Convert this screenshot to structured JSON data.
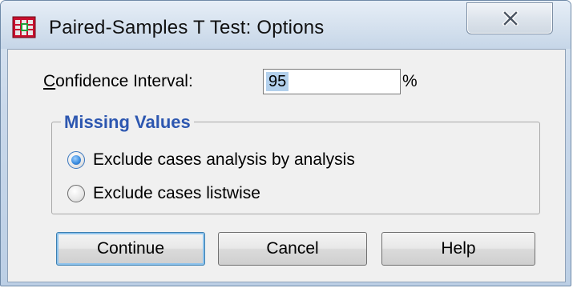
{
  "window": {
    "title": "Paired-Samples T Test: Options",
    "close_label": "Close"
  },
  "confidence": {
    "label_first": "C",
    "label_rest": "onfidence Interval:",
    "value": "95",
    "suffix": "%"
  },
  "missing_values": {
    "title": "Missing Values",
    "options": [
      {
        "label": "Exclude cases analysis by analysis",
        "selected": true
      },
      {
        "label": "Exclude cases listwise",
        "selected": false
      }
    ]
  },
  "buttons": {
    "continue": "Continue",
    "cancel": "Cancel",
    "help": "Help"
  },
  "colors": {
    "group_title": "#2d57b0",
    "selection": "#b3d0ec"
  },
  "icons": {
    "app": "spss-table-icon",
    "close": "close-icon"
  }
}
